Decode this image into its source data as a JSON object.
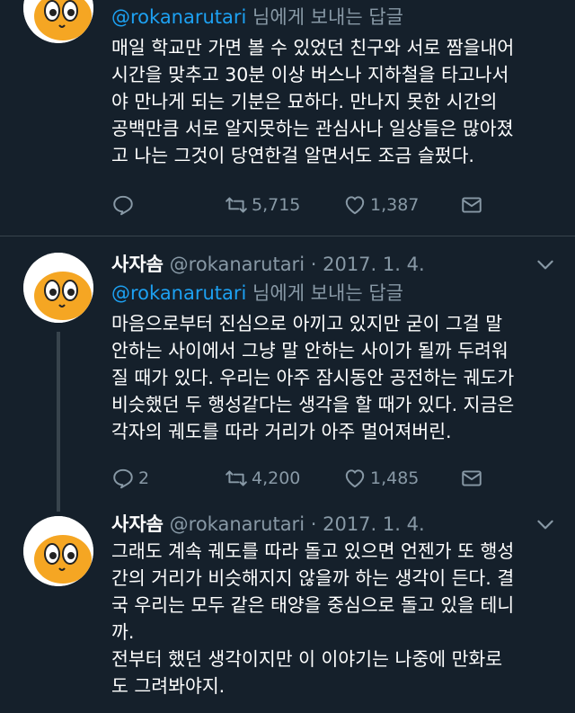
{
  "tweets": [
    {
      "reply_to": {
        "mention": "@rokanarutari",
        "suffix": " 님에게 보내는 답글"
      },
      "lines": [
        "매일 학교만 가면 볼 수 있었던 친구와 서로 짬을내어",
        "시간을 맞추고 30분 이상 버스나 지하철을 타고나서",
        "야 만나게 되는 기분은 묘하다. 만나지 못한 시간의",
        "공백만큼 서로 알지못하는 관심사나 일상들은 많아졌",
        "고 나는 그것이 당연한걸 알면서도 조금 슬펐다."
      ],
      "actions": {
        "replies": "",
        "retweets": "5,715",
        "likes": "1,387"
      }
    },
    {
      "name": "사자솜",
      "handle": "@rokanarutari",
      "separator": "·",
      "date": "2017. 1. 4.",
      "reply_to": {
        "mention": "@rokanarutari",
        "suffix": " 님에게 보내는 답글"
      },
      "lines": [
        "마음으로부터 진심으로 아끼고 있지만 굳이 그걸 말",
        "안하는 사이에서 그냥 말 안하는 사이가 될까 두려워",
        "질 때가 있다. 우리는 아주 잠시동안 공전하는 궤도가",
        "비슷했던 두 행성같다는 생각을 할 때가 있다. 지금은",
        "각자의 궤도를 따라 거리가 아주 멀어져버린."
      ],
      "actions": {
        "replies": "2",
        "retweets": "4,200",
        "likes": "1,485"
      }
    },
    {
      "name": "사자솜",
      "handle": "@rokanarutari",
      "separator": "·",
      "date": "2017. 1. 4.",
      "lines": [
        "그래도 계속 궤도를 따라 돌고 있으면 언젠가 또 행성",
        "간의 거리가 비슷해지지 않을까 하는 생각이 든다. 결",
        "국 우리는 모두 같은 태양을 중심으로 돌고 있을 테니",
        "까.",
        "전부터 했던 생각이지만 이 이야기는 나중에 만화로",
        "도 그려봐야지."
      ]
    }
  ],
  "colors": {
    "background": "#15202b",
    "divider": "#38444d",
    "secondary_text": "#8899a6",
    "link": "#1da1f2",
    "avatar_face": "#f5a623"
  },
  "icons": {
    "reply": "reply-icon",
    "retweet": "retweet-icon",
    "like": "heart-icon",
    "message": "envelope-icon",
    "more": "chevron-down-icon"
  }
}
